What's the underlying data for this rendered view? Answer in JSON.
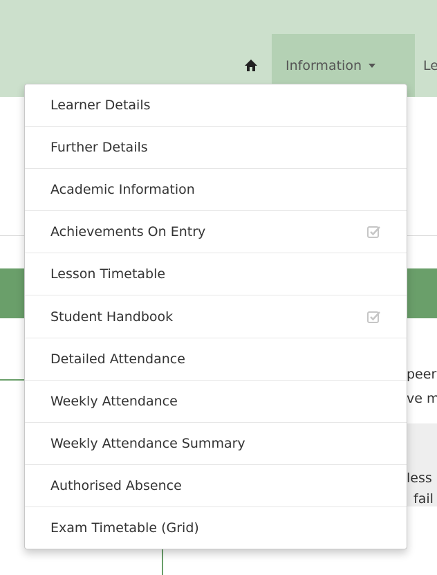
{
  "nav": {
    "home_icon": "home-icon",
    "information_label": "Information",
    "next_label": "Le"
  },
  "background_text": {
    "line1": "peer",
    "line2": "ve m",
    "line3": "less",
    "line4": "fail"
  },
  "menu": {
    "items": [
      {
        "label": "Learner Details",
        "checked": false
      },
      {
        "label": "Further Details",
        "checked": false
      },
      {
        "label": "Academic Information",
        "checked": false
      },
      {
        "label": "Achievements On Entry",
        "checked": true
      },
      {
        "label": "Lesson Timetable",
        "checked": false
      },
      {
        "label": "Student Handbook",
        "checked": true
      },
      {
        "label": "Detailed Attendance",
        "checked": false
      },
      {
        "label": "Weekly Attendance",
        "checked": false
      },
      {
        "label": "Weekly Attendance Summary",
        "checked": false
      },
      {
        "label": "Authorised Absence",
        "checked": false
      },
      {
        "label": "Exam Timetable (Grid)",
        "checked": false
      }
    ],
    "check_icon": "checked-checkbox-icon"
  },
  "colors": {
    "topbar": "#cce0cc",
    "active_nav": "#b4d1b4",
    "accent_green": "#6a9f6a"
  }
}
